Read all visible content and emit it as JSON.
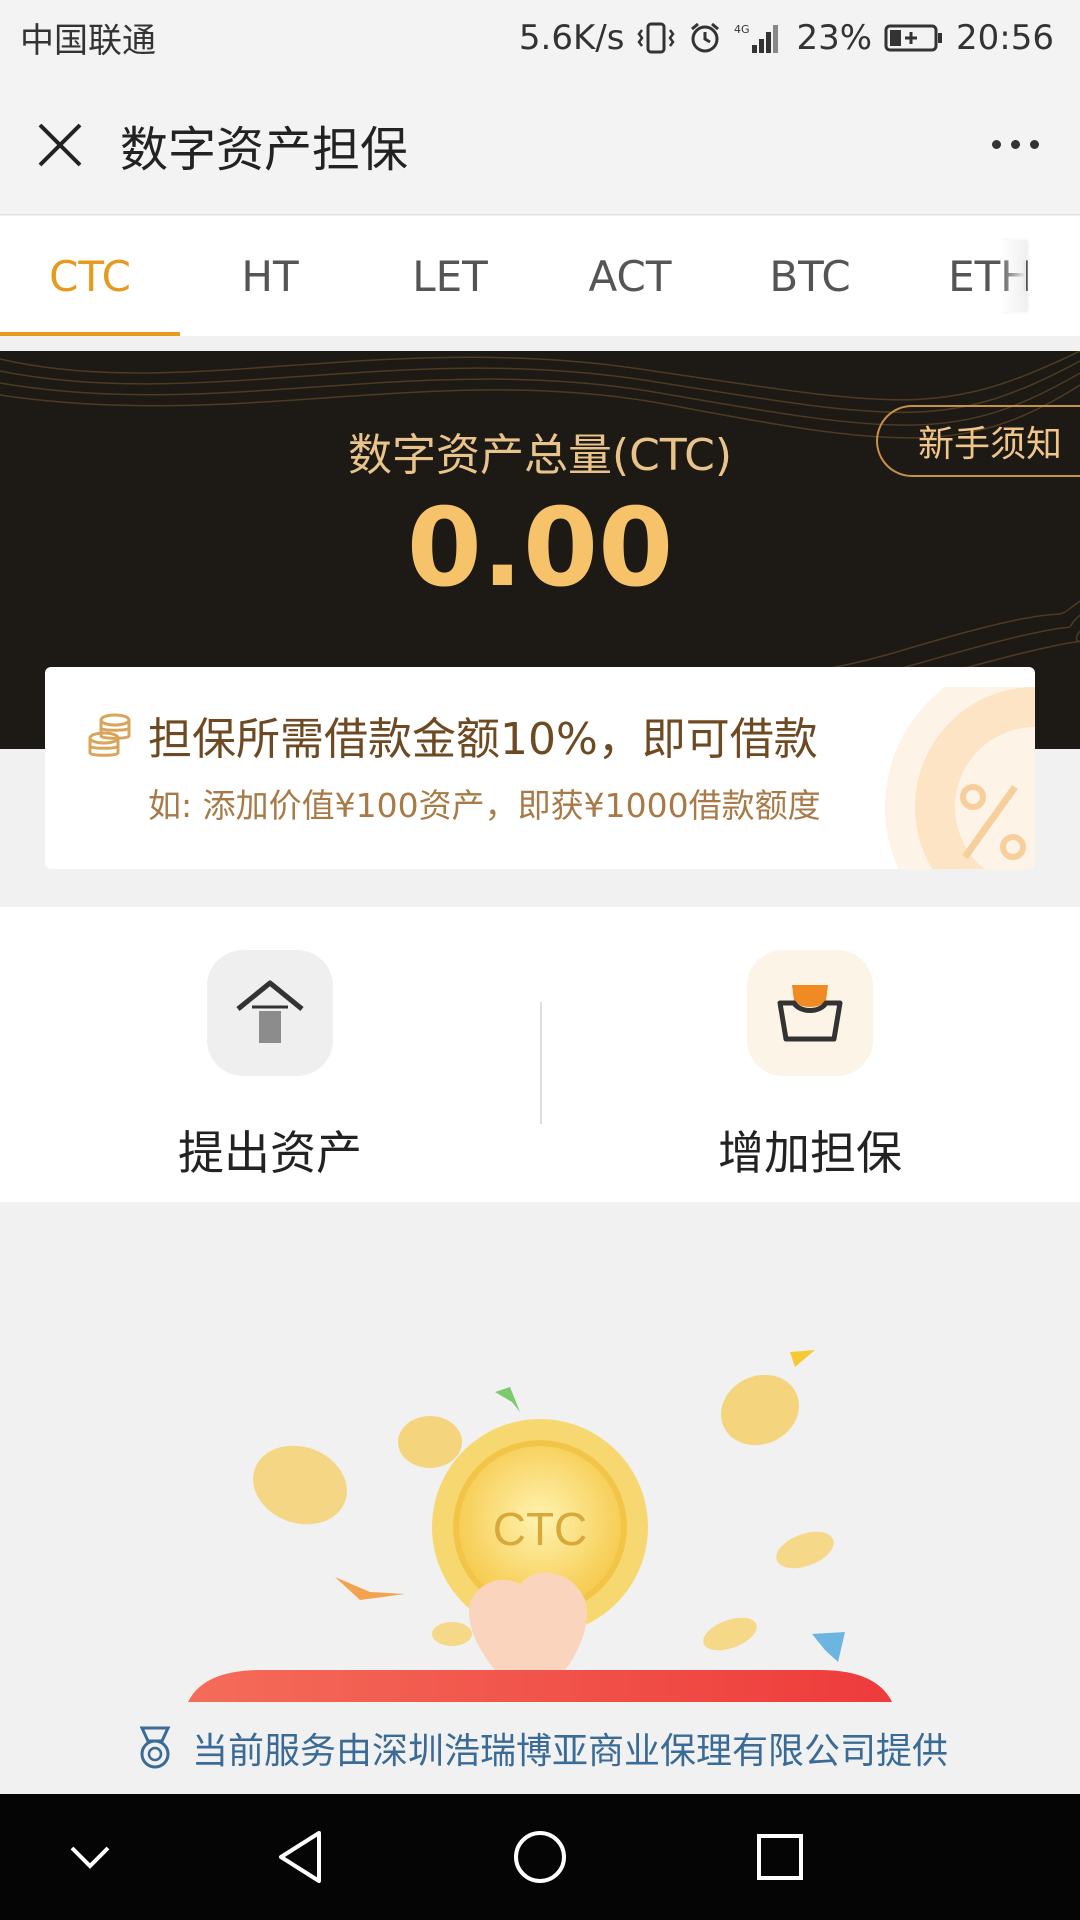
{
  "status_bar": {
    "carrier": "中国联通",
    "speed": "5.6K/s",
    "network": "4G",
    "battery": "23%",
    "time": "20:56"
  },
  "nav": {
    "title": "数字资产担保",
    "close_icon": "close-icon",
    "more_icon": "more-icon"
  },
  "tabs": [
    {
      "label": "CTC",
      "active": true
    },
    {
      "label": "HT",
      "active": false
    },
    {
      "label": "LET",
      "active": false
    },
    {
      "label": "ACT",
      "active": false
    },
    {
      "label": "BTC",
      "active": false
    },
    {
      "label": "ETH",
      "active": false
    }
  ],
  "banner": {
    "label": "数字资产总量(CTC)",
    "value": "0.00",
    "guide_button": "新手须知"
  },
  "promo": {
    "title": "担保所需借款金额10%，即可借款",
    "subtitle": "如: 添加价值¥100资产，即获¥1000借款额度",
    "icon": "coins-icon"
  },
  "actions": [
    {
      "label": "提出资产",
      "icon": "withdraw-arrow-icon"
    },
    {
      "label": "增加担保",
      "icon": "add-guarantee-icon"
    }
  ],
  "illustration": {
    "coin_label": "CTC"
  },
  "footer": {
    "text": "当前服务由深圳浩瑞博亚商业保理有限公司提供",
    "icon": "medal-icon"
  },
  "colors": {
    "accent": "#e69a1e",
    "banner_bg": "#1d1915",
    "gold": "#f6c36a",
    "footer_text": "#3a6b96"
  }
}
